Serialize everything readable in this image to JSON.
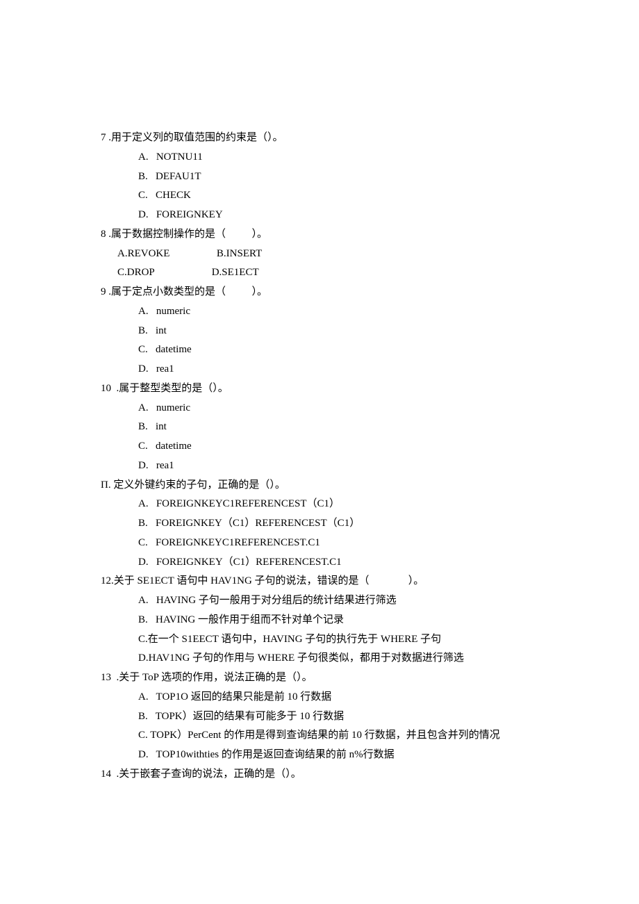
{
  "q7": {
    "stem": "7 .用于定义列的取值范围的约束是（）。",
    "a": "A.   NOTNU11",
    "b": "B.   DEFAU1T",
    "c": "C.   CHECK",
    "d": "D.   FOREIGNKEY"
  },
  "q8": {
    "stem": "8 .属于数据控制操作的是（          ）。",
    "row1": "A.REVOKE                  B.INSERT",
    "row2": "C.DROP                      D.SE1ECT"
  },
  "q9": {
    "stem": "9 .属于定点小数类型的是（          ）。",
    "a": "A.   numeric",
    "b": "B.   int",
    "c": "C.   datetime",
    "d": "D.   rea1"
  },
  "q10": {
    "stem": "10  .属于整型类型的是（）。",
    "a": "A.   numeric",
    "b": "B.   int",
    "c": "C.   datetime",
    "d": "D.   rea1"
  },
  "q11": {
    "stem": "Π. 定义外键约束的子句，正确的是（）。",
    "a": "A.   FOREIGNKEYC1REFERENCEST（C1）",
    "b": "B.   FOREIGNKEY（C1）REFERENCEST（C1）",
    "c": "C.   FOREIGNKEYC1REFERENCEST.C1",
    "d": "D.   FOREIGNKEY（C1）REFERENCEST.C1"
  },
  "q12": {
    "stem": "12.关于 SE1ECT 语句中 HAV1NG 子句的说法，错误的是（               ）。",
    "a": "A.   HAVING 子句一般用于对分组后的统计结果进行筛选",
    "b": "B.   HAVING 一般作用于组而不针对单个记录",
    "c": "C.在一个 S1EECT 语句中，HAVING 子句的执行先于 WHERE 子句",
    "d": "D.HAV1NG 子句的作用与 WHERE 子句很类似，都用于对数据进行筛选"
  },
  "q13": {
    "stem": "13  .关于 ToP 选项的作用，说法正确的是（）。",
    "a": "A.   TOP1O 返回的结果只能是前 10 行数据",
    "b": "B.   TOPK）返回的结果有可能多于 10 行数据",
    "c": "C.   TOPK）PerCent 的作用是得到查询结果的前 10 行数据，并且包含并列的情况",
    "d": "D.   TOP10withties 的作用是返回查询结果的前 n%行数据"
  },
  "q14": {
    "stem": "14  .关于嵌套子查询的说法，正确的是（）。"
  }
}
